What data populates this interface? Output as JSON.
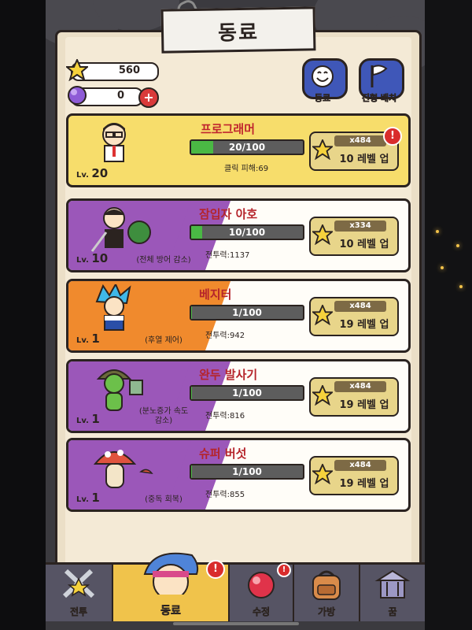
{
  "title": "동료",
  "resources": {
    "stars": "560",
    "orbs": "0",
    "plus_symbol": "+"
  },
  "top_buttons": [
    {
      "label": "동료",
      "icon": "smiley-face-icon"
    },
    {
      "label": "진형 배치",
      "icon": "flag-icon"
    }
  ],
  "companions": [
    {
      "name": "프로그래머",
      "level_prefix": "Lv.",
      "level": "20",
      "progress": "20/100",
      "progress_fraction": 0.2,
      "stat": "클릭 피해:69",
      "skill": "",
      "cost": "x484",
      "upgrade": "10 레벨 업",
      "alert": "!",
      "theme": "gold",
      "band_color": "#f7dd6b"
    },
    {
      "name": "잠입자 아호",
      "level_prefix": "Lv.",
      "level": "10",
      "progress": "10/100",
      "progress_fraction": 0.1,
      "stat": "전투력:1137",
      "skill": "(전체 방어 감소)",
      "cost": "x334",
      "upgrade": "10 레벨 업",
      "alert": "",
      "theme": "purple",
      "band_color": "#9b57b9"
    },
    {
      "name": "베지터",
      "level_prefix": "Lv.",
      "level": "1",
      "progress": "1/100",
      "progress_fraction": 0.01,
      "stat": "전투력:942",
      "skill": "(후열 제어)",
      "cost": "x484",
      "upgrade": "19 레벨 업",
      "alert": "",
      "theme": "orange",
      "band_color": "#f08a2d"
    },
    {
      "name": "완두 발사기",
      "level_prefix": "Lv.",
      "level": "1",
      "progress": "1/100",
      "progress_fraction": 0.01,
      "stat": "전투력:816",
      "skill": "(분노증가 속도 감소)",
      "cost": "x484",
      "upgrade": "19 레벨 업",
      "alert": "",
      "theme": "purple",
      "band_color": "#9b57b9"
    },
    {
      "name": "슈퍼 버섯",
      "level_prefix": "Lv.",
      "level": "1",
      "progress": "1/100",
      "progress_fraction": 0.01,
      "stat": "전투력:855",
      "skill": "(중독 회복)",
      "cost": "x484",
      "upgrade": "19 레벨 업",
      "alert": "",
      "theme": "purple",
      "band_color": "#9b57b9"
    }
  ],
  "tabs": [
    {
      "label": "전투",
      "icon": "battle-icon",
      "active": false,
      "alert": ""
    },
    {
      "label": "동료",
      "icon": "hero-face-icon",
      "active": true,
      "alert": "!"
    },
    {
      "label": "수정",
      "icon": "red-crystal-icon",
      "active": false,
      "alert": "!"
    },
    {
      "label": "가방",
      "icon": "backpack-icon",
      "active": false,
      "alert": ""
    },
    {
      "label": "꿈",
      "icon": "dream-temple-icon",
      "active": false,
      "alert": ""
    }
  ]
}
